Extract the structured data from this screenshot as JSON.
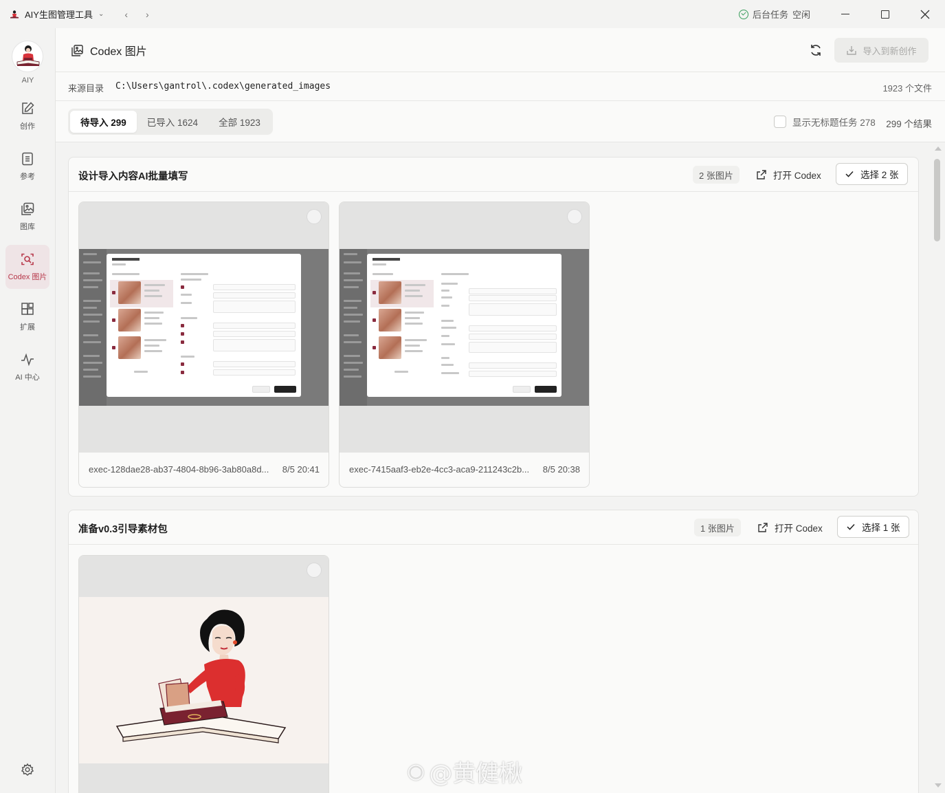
{
  "app": {
    "title": "AIY生图管理工具",
    "brand_label": "AIY",
    "accent_color": "#b7384a"
  },
  "titlebar": {
    "back_icon": "chevron-left-icon",
    "forward_icon": "chevron-right-icon",
    "bg_task_label": "后台任务",
    "bg_task_status": "空闲"
  },
  "sidebar": {
    "items": [
      {
        "label": "创作",
        "icon": "edit-icon"
      },
      {
        "label": "参考",
        "icon": "document-icon"
      },
      {
        "label": "图库",
        "icon": "gallery-icon"
      },
      {
        "label": "Codex 图片",
        "icon": "codex-scan-icon",
        "active": true
      },
      {
        "label": "扩展",
        "icon": "extensions-icon"
      },
      {
        "label": "AI 中心",
        "icon": "pulse-icon"
      }
    ],
    "settings_icon": "gear-icon"
  },
  "header": {
    "title": "Codex 图片",
    "import_button": "导入到新创作"
  },
  "source": {
    "label": "来源目录",
    "path": "C:\\Users\\gantrol\\.codex\\generated_images",
    "file_count": "1923 个文件"
  },
  "filters": {
    "tabs": [
      {
        "label": "待导入 299",
        "active": true
      },
      {
        "label": "已导入 1624",
        "active": false
      },
      {
        "label": "全部 1923",
        "active": false
      }
    ],
    "untitled_toggle": "显示无标题任务 278",
    "result_count": "299 个结果"
  },
  "groups": [
    {
      "title": "设计导入内容AI批量填写",
      "image_count": "2 张图片",
      "open_codex": "打开 Codex",
      "select_label": "选择 2 张",
      "cards": [
        {
          "name": "exec-128dae28-ab37-4804-8b96-3ab80a8d...",
          "time": "8/5 20:41"
        },
        {
          "name": "exec-7415aaf3-eb2e-4cc3-aca9-211243c2b...",
          "time": "8/5 20:38"
        }
      ]
    },
    {
      "title": "准备v0.3引导素材包",
      "image_count": "1 张图片",
      "open_codex": "打开 Codex",
      "select_label": "选择 1 张",
      "cards": []
    }
  ],
  "watermark": "@黄健楸"
}
